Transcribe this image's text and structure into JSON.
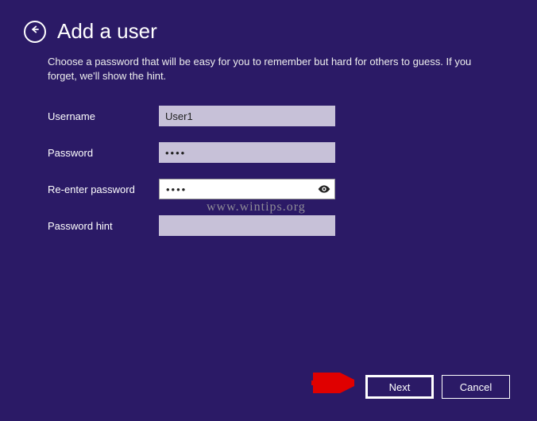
{
  "header": {
    "title": "Add a user"
  },
  "description": "Choose a password that will be easy for you to remember but hard for others to guess. If you forget, we'll show the hint.",
  "form": {
    "username": {
      "label": "Username",
      "value": "User1"
    },
    "password": {
      "label": "Password",
      "value": "••••"
    },
    "reenter": {
      "label": "Re-enter password",
      "value": "••••"
    },
    "hint": {
      "label": "Password hint",
      "value": ""
    }
  },
  "watermark": "www.wintips.org",
  "buttons": {
    "next": "Next",
    "cancel": "Cancel"
  }
}
